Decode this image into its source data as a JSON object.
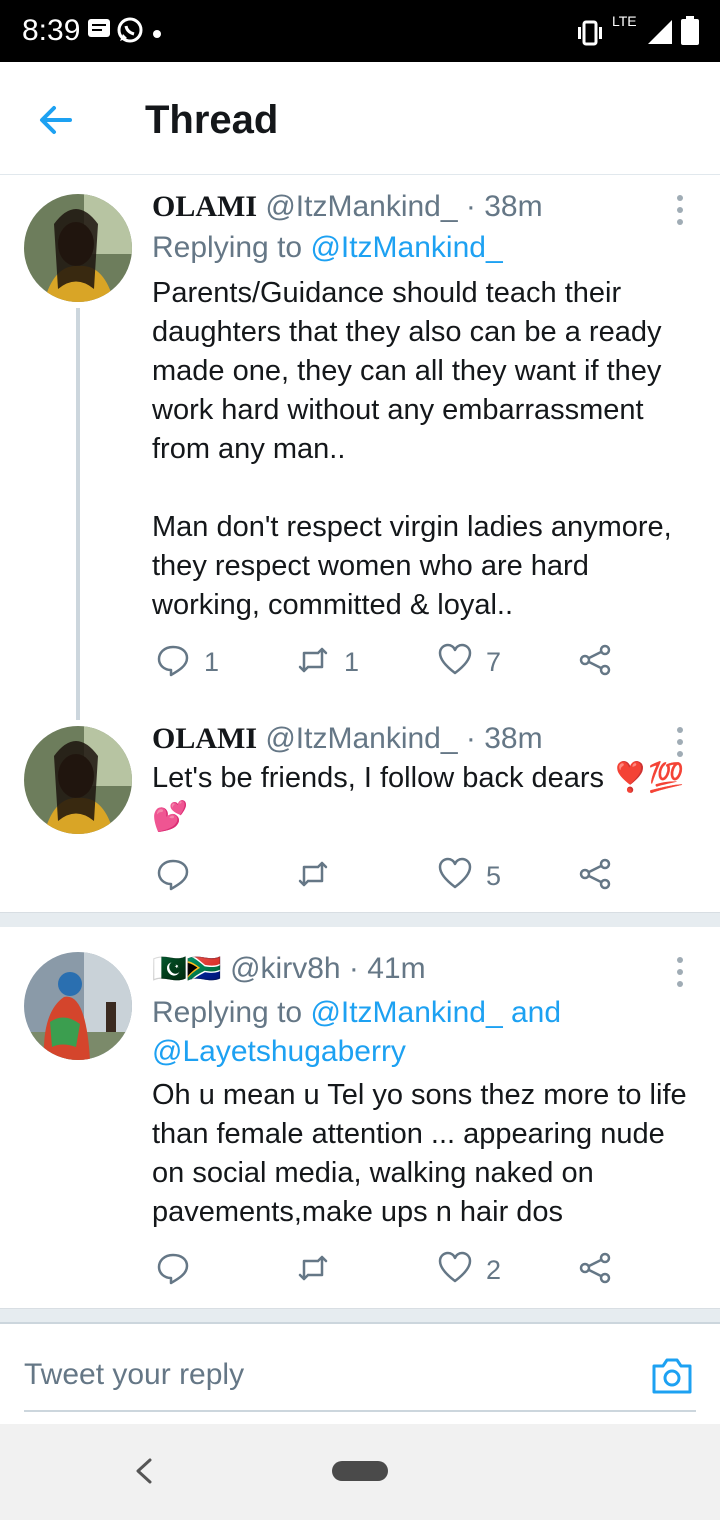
{
  "status_bar": {
    "time": "8:39",
    "network": "LTE",
    "left_icons": [
      "message-icon",
      "whatsapp-icon",
      "dot-icon"
    ],
    "right_icons": [
      "vibrate-icon",
      "lte-icon",
      "signal-icon",
      "battery-icon"
    ]
  },
  "header": {
    "title": "Thread"
  },
  "tweets": [
    {
      "name": "OLAMI",
      "handle": "@ItzMankind_",
      "time": "· 38m",
      "replying_prefix": "Replying to",
      "replying_handle": "@ItzMankind_",
      "text": "Parents/Guidance should teach their daughters that they also can be a ready made one, they can all they want if they work hard without any embarrassment from any man..\n\nMan don't respect virgin ladies anymore, they respect women who are hard working, committed & loyal..",
      "replies": "1",
      "retweets": "1",
      "likes": "7"
    },
    {
      "name": "OLAMI",
      "handle": "@ItzMankind_",
      "time": "· 38m",
      "text": "Let's be friends, I follow back dears ❣️💯 💕",
      "replies": "",
      "retweets": "",
      "likes": "5"
    },
    {
      "name_flags": "🇵🇰🇿🇦",
      "handle": "@kirv8h",
      "time": "· 41m",
      "replying_prefix": "Replying to",
      "replying_handle": "@ItzMankind_",
      "replying_and": "and",
      "replying_handle2": "@Layetshugaberry",
      "text": "Oh u mean u Tel yo sons thez more to life than female  attention ... appearing nude on social media, walking naked on pavements,make ups n hair dos",
      "replies": "",
      "retweets": "",
      "likes": "2"
    }
  ],
  "reply_bar": {
    "placeholder": "Tweet your reply"
  },
  "colors": {
    "accent": "#1da1f2",
    "muted": "#657786",
    "divider": "#e6ecf0",
    "statusbar": "#000000"
  }
}
